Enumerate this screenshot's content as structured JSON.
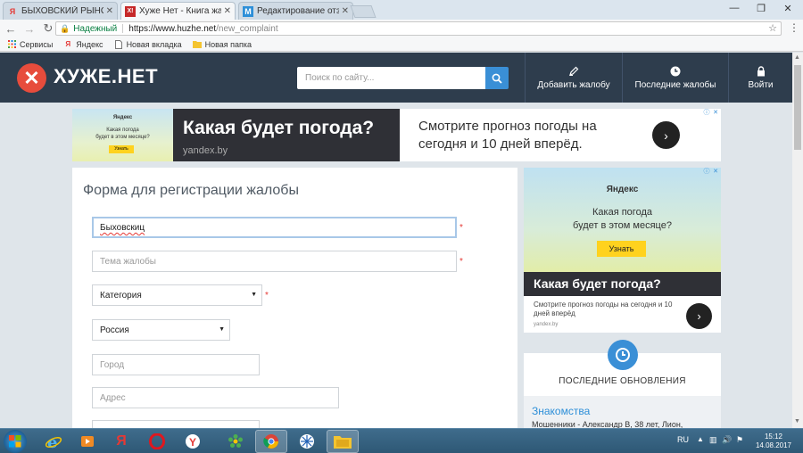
{
  "browser": {
    "tabs": [
      {
        "label": "БЫХОВСКИЙ РЫНОК В",
        "favicon": "Я",
        "active": false
      },
      {
        "label": "Хуже Нет - Книга жалоб",
        "favicon": "X!",
        "active": true
      },
      {
        "label": "Редактирование отзыва",
        "favicon": "M",
        "active": false
      }
    ],
    "secure_label": "Надежный",
    "url_host": "https://www.huzhe.net",
    "url_path": "/new_complaint",
    "bookmarks": [
      {
        "label": "Сервисы",
        "icon": "apps-grid-icon"
      },
      {
        "label": "Яндекс",
        "icon": "yandex-icon"
      },
      {
        "label": "Новая вкладка",
        "icon": "page-icon"
      },
      {
        "label": "Новая папка",
        "icon": "folder-icon"
      }
    ]
  },
  "site": {
    "logo_symbol": "✕",
    "logo_text": "ХУЖЕ.НЕТ",
    "search_placeholder": "Поиск по сайту...",
    "nav": [
      {
        "label": "Добавить жалобу",
        "icon": "pencil-icon"
      },
      {
        "label": "Последние жалобы",
        "icon": "clock-icon"
      },
      {
        "label": "Войти",
        "icon": "lock-icon"
      }
    ]
  },
  "top_ad": {
    "thumb_brand": "Яндекс",
    "thumb_line1": "Какая погода",
    "thumb_line2": "будет в этом месяце?",
    "thumb_button": "Узнать",
    "headline": "Какая будет погода?",
    "domain": "yandex.by",
    "text": "Смотрите прогноз погоды на сегодня и 10 дней вперёд.",
    "arrow": "›"
  },
  "form": {
    "title": "Форма для регистрации жалобы",
    "company_value": "Быховскиц",
    "subject_placeholder": "Тема жалобы",
    "category_value": "Категория",
    "country_value": "Россия",
    "city_placeholder": "Город",
    "address_placeholder": "Адрес",
    "required_mark": "*"
  },
  "side_ad": {
    "brand": "Яндекс",
    "line1": "Какая погода",
    "line2": "будет в этом месяце?",
    "button": "Узнать",
    "headline": "Какая будет погода?",
    "text": "Смотрите прогноз погоды на сегодня и 10 дней вперёд",
    "domain": "yandex.by",
    "arrow": "›"
  },
  "updates": {
    "title": "ПОСЛЕДНИЕ ОБНОВЛЕНИЯ",
    "category": "Знакомства",
    "line": "Мошенники - Александр В, 38 лет, Лион,"
  },
  "taskbar": {
    "lang": "RU",
    "time": "15:12",
    "date": "14.08.2017"
  },
  "colors": {
    "header_bg": "#2e3d4d",
    "logo_red": "#e74c3c",
    "accent_blue": "#3a8fd6",
    "required_red": "#e53935",
    "ad_dark": "#2f3036",
    "link_blue": "#2d8fd8"
  }
}
